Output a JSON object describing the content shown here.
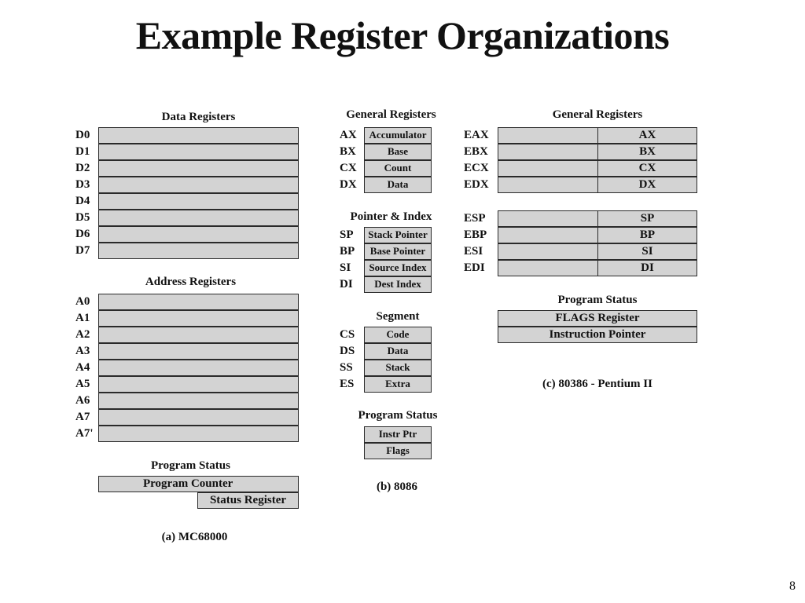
{
  "slide": {
    "title": "Example Register Organizations",
    "page_number": "8"
  },
  "mc68000": {
    "caption": "(a) MC68000",
    "data_registers": {
      "heading": "Data Registers",
      "labels": [
        "D0",
        "D1",
        "D2",
        "D3",
        "D4",
        "D5",
        "D6",
        "D7"
      ]
    },
    "address_registers": {
      "heading": "Address Registers",
      "labels": [
        "A0",
        "A1",
        "A2",
        "A3",
        "A4",
        "A5",
        "A6",
        "A7",
        "A7'"
      ]
    },
    "program_status": {
      "heading": "Program Status",
      "program_counter": "Program Counter",
      "status_register": "Status Register"
    }
  },
  "i8086": {
    "caption": "(b) 8086",
    "general_registers": {
      "heading": "General Registers",
      "rows": [
        {
          "label": "AX",
          "name": "Accumulator"
        },
        {
          "label": "BX",
          "name": "Base"
        },
        {
          "label": "CX",
          "name": "Count"
        },
        {
          "label": "DX",
          "name": "Data"
        }
      ]
    },
    "pointer_index": {
      "heading": "Pointer & Index",
      "rows": [
        {
          "label": "SP",
          "name": "Stack Pointer"
        },
        {
          "label": "BP",
          "name": "Base Pointer"
        },
        {
          "label": "SI",
          "name": "Source Index"
        },
        {
          "label": "DI",
          "name": "Dest Index"
        }
      ]
    },
    "segment": {
      "heading": "Segment",
      "rows": [
        {
          "label": "CS",
          "name": "Code"
        },
        {
          "label": "DS",
          "name": "Data"
        },
        {
          "label": "SS",
          "name": "Stack"
        },
        {
          "label": "ES",
          "name": "Extra"
        }
      ]
    },
    "program_status": {
      "heading": "Program Status",
      "rows": [
        "Instr Ptr",
        "Flags"
      ]
    }
  },
  "i80386": {
    "caption": "(c) 80386 - Pentium II",
    "general_registers": {
      "heading": "General Registers",
      "rows": [
        {
          "label": "EAX",
          "low": "AX"
        },
        {
          "label": "EBX",
          "low": "BX"
        },
        {
          "label": "ECX",
          "low": "CX"
        },
        {
          "label": "EDX",
          "low": "DX"
        }
      ]
    },
    "pointer_index": {
      "rows": [
        {
          "label": "ESP",
          "low": "SP"
        },
        {
          "label": "EBP",
          "low": "BP"
        },
        {
          "label": "ESI",
          "low": "SI"
        },
        {
          "label": "EDI",
          "low": "DI"
        }
      ]
    },
    "program_status": {
      "heading": "Program Status",
      "rows": [
        "FLAGS Register",
        "Instruction Pointer"
      ]
    }
  }
}
